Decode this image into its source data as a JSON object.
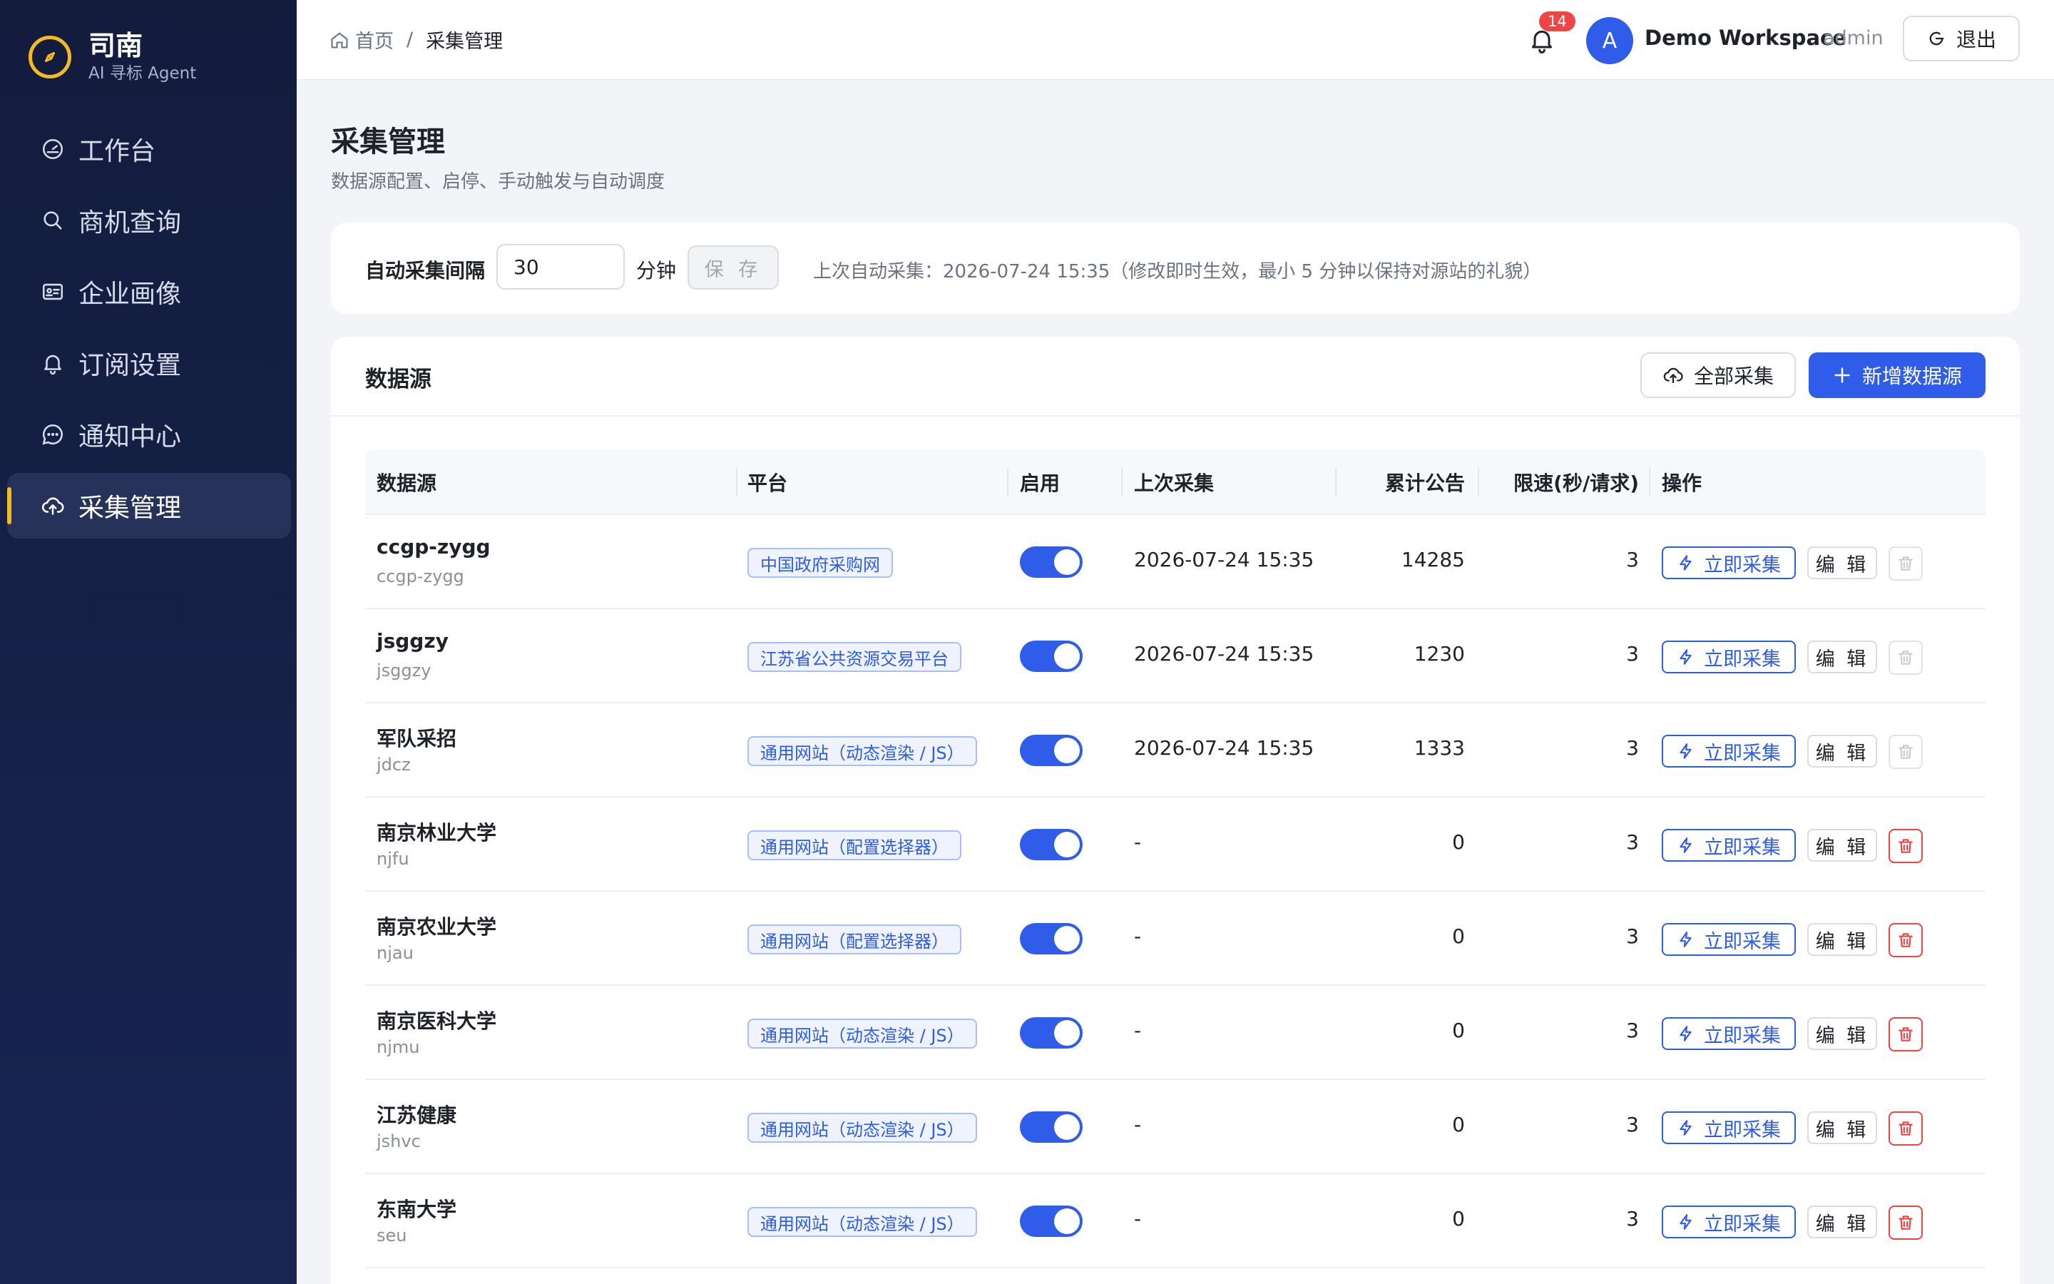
{
  "brand": {
    "name": "司南",
    "subtitle": "AI 寻标 Agent"
  },
  "sidebar": {
    "items": [
      {
        "label": "工作台",
        "icon": "dashboard-icon",
        "active": false
      },
      {
        "label": "商机查询",
        "icon": "search-icon",
        "active": false
      },
      {
        "label": "企业画像",
        "icon": "id-card-icon",
        "active": false
      },
      {
        "label": "订阅设置",
        "icon": "bell-icon",
        "active": false
      },
      {
        "label": "通知中心",
        "icon": "chat-icon",
        "active": false
      },
      {
        "label": "采集管理",
        "icon": "cloud-upload-icon",
        "active": true
      }
    ]
  },
  "header": {
    "breadcrumb_home": "首页",
    "breadcrumb_sep": "/",
    "breadcrumb_current": "采集管理",
    "notification_count": "14",
    "avatar_letter": "A",
    "workspace_name": "Demo Workspace",
    "user_role": "admin",
    "logout_label": "退出"
  },
  "page": {
    "title": "采集管理",
    "subtitle": "数据源配置、启停、手动触发与自动调度"
  },
  "settings": {
    "interval_label": "自动采集间隔",
    "interval_value": "30",
    "interval_unit": "分钟",
    "save_label": "保 存",
    "note": "上次自动采集：2026-07-24 15:35（修改即时生效，最小 5 分钟以保持对源站的礼貌）"
  },
  "sources": {
    "title": "数据源",
    "collect_all_label": "全部采集",
    "add_label": "新增数据源",
    "columns": {
      "source": "数据源",
      "platform": "平台",
      "enabled": "启用",
      "last_run": "上次采集",
      "total": "累计公告",
      "rate": "限速(秒/请求)",
      "actions": "操作"
    },
    "run_label": "立即采集",
    "edit_label": "编 辑",
    "rows": [
      {
        "name": "ccgp-zygg",
        "code": "ccgp-zygg",
        "platform": "中国政府采购网",
        "enabled": true,
        "last_run": "2026-07-24 15:35",
        "total": "14285",
        "rate": "3",
        "deletable": false
      },
      {
        "name": "jsggzy",
        "code": "jsggzy",
        "platform": "江苏省公共资源交易平台",
        "enabled": true,
        "last_run": "2026-07-24 15:35",
        "total": "1230",
        "rate": "3",
        "deletable": false
      },
      {
        "name": "军队采招",
        "code": "jdcz",
        "platform": "通用网站（动态渲染 / JS）",
        "enabled": true,
        "last_run": "2026-07-24 15:35",
        "total": "1333",
        "rate": "3",
        "deletable": false
      },
      {
        "name": "南京林业大学",
        "code": "njfu",
        "platform": "通用网站（配置选择器）",
        "enabled": true,
        "last_run": "-",
        "total": "0",
        "rate": "3",
        "deletable": true
      },
      {
        "name": "南京农业大学",
        "code": "njau",
        "platform": "通用网站（配置选择器）",
        "enabled": true,
        "last_run": "-",
        "total": "0",
        "rate": "3",
        "deletable": true
      },
      {
        "name": "南京医科大学",
        "code": "njmu",
        "platform": "通用网站（动态渲染 / JS）",
        "enabled": true,
        "last_run": "-",
        "total": "0",
        "rate": "3",
        "deletable": true
      },
      {
        "name": "江苏健康",
        "code": "jshvc",
        "platform": "通用网站（动态渲染 / JS）",
        "enabled": true,
        "last_run": "-",
        "total": "0",
        "rate": "3",
        "deletable": true
      },
      {
        "name": "东南大学",
        "code": "seu",
        "platform": "通用网站（动态渲染 / JS）",
        "enabled": true,
        "last_run": "-",
        "total": "0",
        "rate": "3",
        "deletable": true
      }
    ]
  },
  "colors": {
    "primary": "#2f5ce9",
    "sidebar_bg": "#131c3d",
    "accent": "#f5b921",
    "danger": "#ef4444"
  }
}
